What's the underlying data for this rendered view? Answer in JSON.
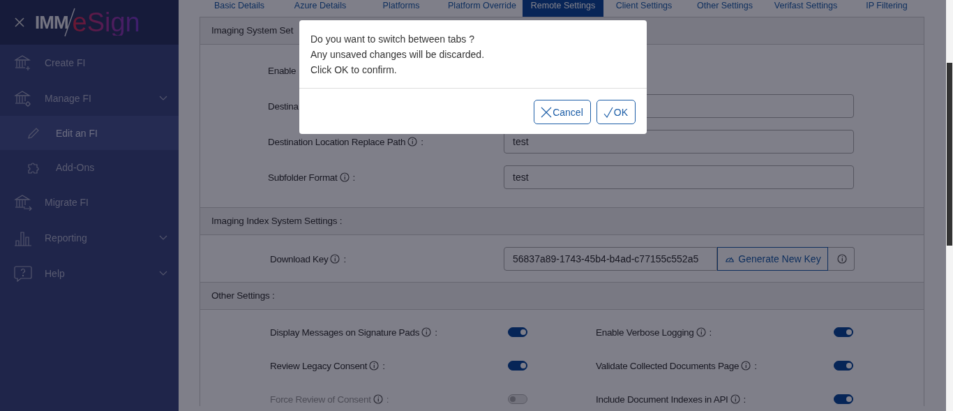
{
  "sidebar": {
    "brand": {
      "prefix": "IMM",
      "name": "eSign"
    },
    "items": [
      {
        "label": "Create FI",
        "kind": "bank-plus",
        "expandable": false,
        "selected": false
      },
      {
        "label": "Manage FI",
        "kind": "bank-gear",
        "expandable": true,
        "selected": false,
        "children": [
          {
            "label": "Edit an FI",
            "kind": "pencil",
            "selected": true
          },
          {
            "label": "Add-Ons",
            "kind": "puzzle",
            "selected": false
          }
        ]
      },
      {
        "label": "Migrate FI",
        "kind": "bank-arrow",
        "expandable": false,
        "selected": false
      },
      {
        "label": "Reporting",
        "kind": "chart",
        "expandable": true,
        "selected": false
      },
      {
        "label": "Help",
        "kind": "help",
        "expandable": true,
        "selected": false
      }
    ]
  },
  "tabs": [
    {
      "label": "Basic Details",
      "selected": false
    },
    {
      "label": "Azure Details",
      "selected": false
    },
    {
      "label": "Platforms",
      "selected": false
    },
    {
      "label": "Platform Override",
      "selected": false
    },
    {
      "label": "Remote Settings",
      "selected": true
    },
    {
      "label": "Client Settings",
      "selected": false
    },
    {
      "label": "Other Settings",
      "selected": false
    },
    {
      "label": "Verifast Settings",
      "selected": false
    },
    {
      "label": "IP Filtering",
      "selected": false
    }
  ],
  "sections": [
    {
      "title": "Imaging System Set",
      "kind": "fields",
      "rows": [
        {
          "label": "Enable",
          "info": false,
          "kind": "hidden"
        },
        {
          "label": "Destina",
          "info": false,
          "kind": "text"
        },
        {
          "label": "Destination Location Replace Path",
          "info": true,
          "separator": ":",
          "kind": "text",
          "value": "test"
        },
        {
          "label": "Subfolder Format",
          "info": true,
          "separator": ":",
          "kind": "text",
          "value": "test"
        }
      ]
    },
    {
      "title": "Imaging Index System Settings :",
      "kind": "key",
      "rows": [
        {
          "label": "Download Key",
          "info": true,
          "separator": ":",
          "value": "56837a89-1743-45b4-b4ad-c77155c552a5",
          "button": "Generate New Key"
        }
      ]
    },
    {
      "title": "Other Settings :",
      "kind": "toggles",
      "rows": [
        {
          "label": "Display Messages on Signature Pads",
          "info": true,
          "separator": ":",
          "on": true,
          "disabled": false
        },
        {
          "label": "Enable Verbose Logging",
          "info": true,
          "separator": ":",
          "on": true,
          "disabled": false
        },
        {
          "label": "Review Legacy Consent",
          "info": true,
          "separator": ":",
          "on": true,
          "disabled": false
        },
        {
          "label": "Validate Collected Documents Page",
          "info": true,
          "separator": ":",
          "on": true,
          "disabled": false
        },
        {
          "label": "Force Review of Consent",
          "info": true,
          "separator": ":",
          "on": false,
          "disabled": true
        },
        {
          "label": "Include Document Indexes in API",
          "info": true,
          "separator": ":",
          "on": true,
          "disabled": false
        }
      ]
    }
  ],
  "dialog": {
    "lines": [
      "Do you want to switch between tabs ?",
      "Any unsaved changes will be discarded.",
      "Click OK to confirm."
    ],
    "buttons": [
      {
        "label": "Cancel",
        "kind": "cancel"
      },
      {
        "label": "OK",
        "kind": "ok"
      }
    ]
  }
}
